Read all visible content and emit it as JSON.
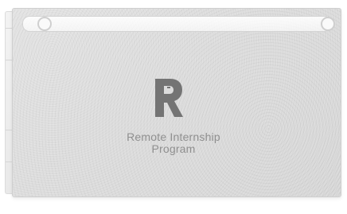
{
  "program": {
    "title_line_1": "Remote Internship",
    "title_line_2": "Program"
  },
  "logo": {
    "glyph": "R",
    "icon_name": "remote-r-logo-icon",
    "color": "#747474"
  },
  "colors": {
    "cover": "#dcdcdc",
    "rail": "#f7f7f7",
    "text": "#8f8f8f"
  }
}
